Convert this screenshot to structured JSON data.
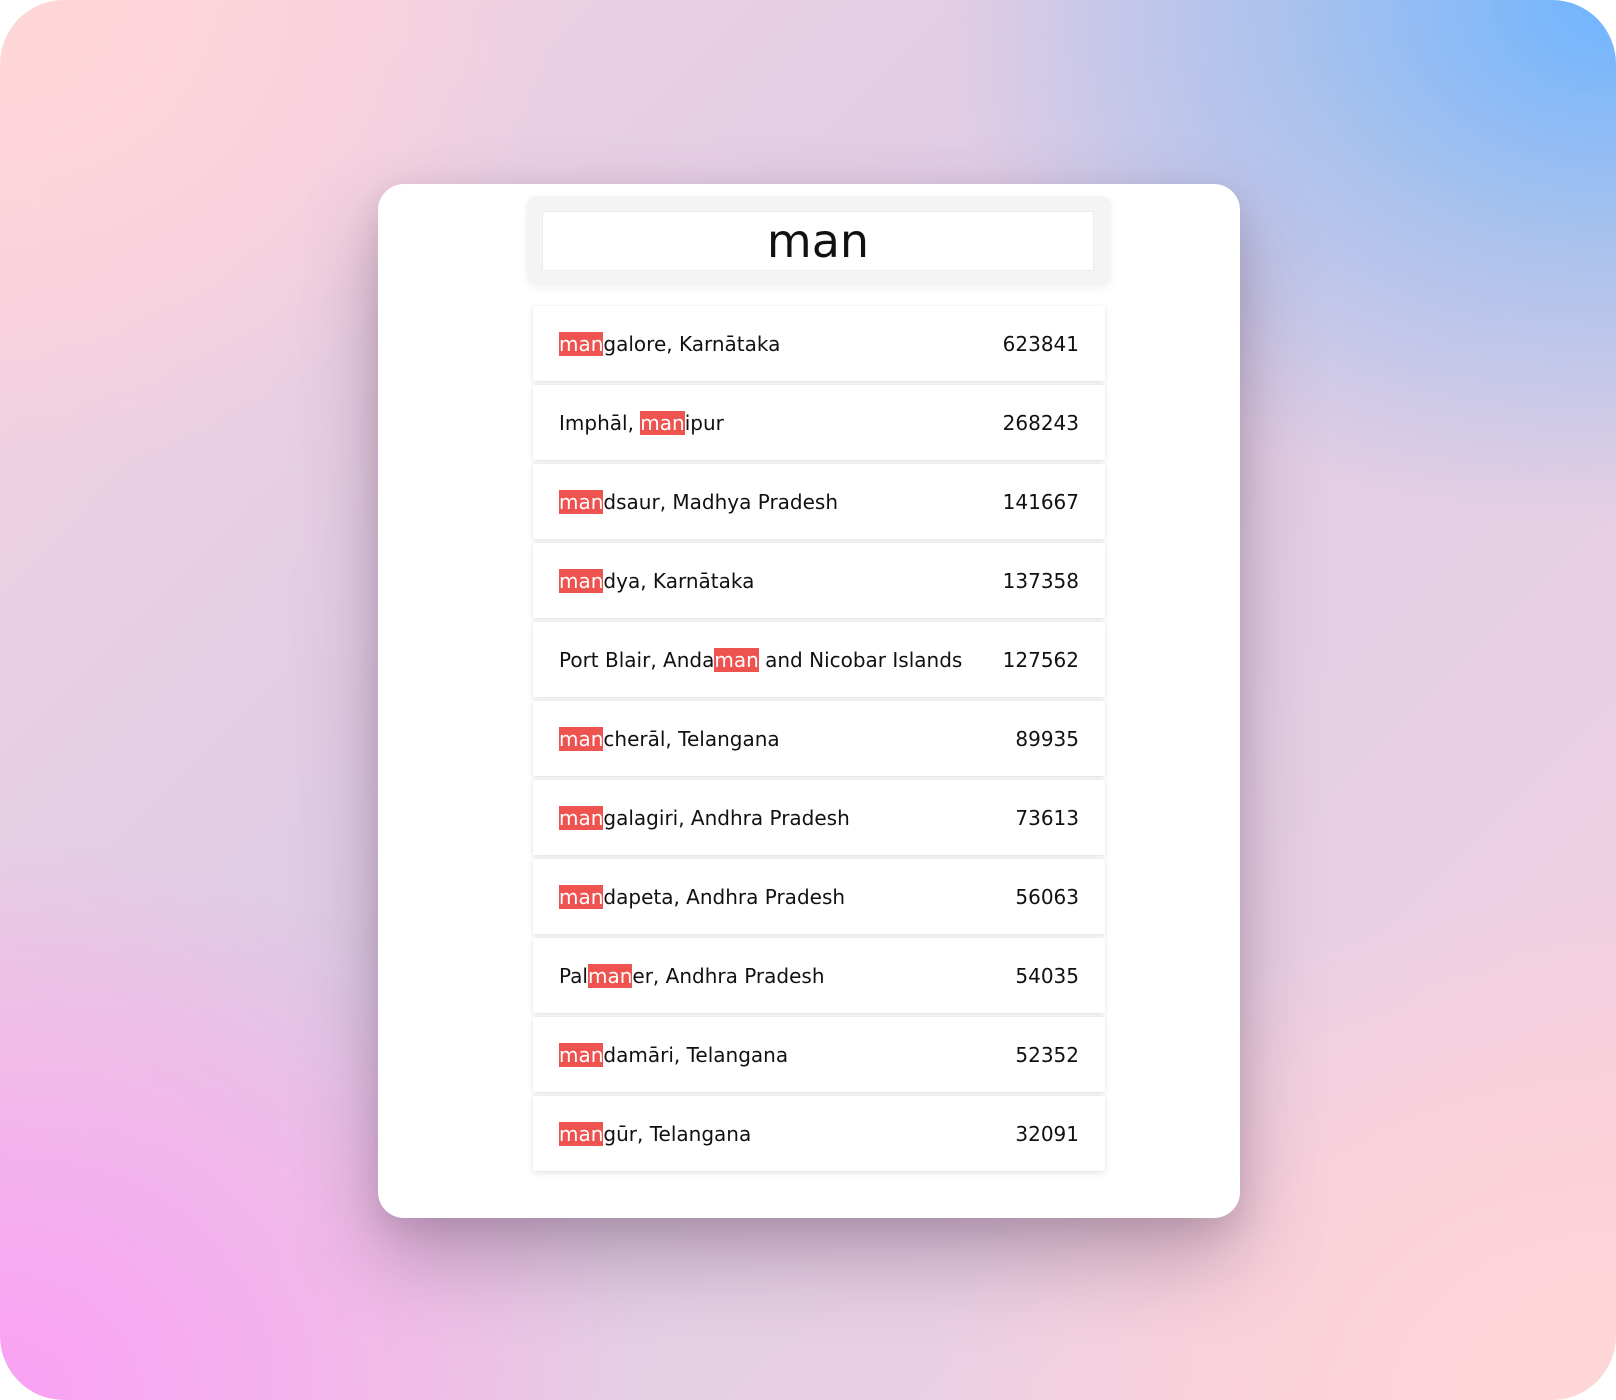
{
  "search": {
    "value": "man",
    "placeholder": ""
  },
  "highlight_color": "#ef5350",
  "results": [
    {
      "pre": "",
      "match": "man",
      "post": "galore, Karnātaka",
      "population": "623841"
    },
    {
      "pre": "Imphāl, ",
      "match": "man",
      "post": "ipur",
      "population": "268243"
    },
    {
      "pre": "",
      "match": "man",
      "post": "dsaur, Madhya Pradesh",
      "population": "141667"
    },
    {
      "pre": "",
      "match": "man",
      "post": "dya, Karnātaka",
      "population": "137358"
    },
    {
      "pre": "Port Blair, Anda",
      "match": "man",
      "post": " and Nicobar Islands",
      "population": "127562"
    },
    {
      "pre": "",
      "match": "man",
      "post": "cherāl, Telangana",
      "population": "89935"
    },
    {
      "pre": "",
      "match": "man",
      "post": "galagiri, Andhra Pradesh",
      "population": "73613"
    },
    {
      "pre": "",
      "match": "man",
      "post": "dapeta, Andhra Pradesh",
      "population": "56063"
    },
    {
      "pre": "Pal",
      "match": "man",
      "post": "er, Andhra Pradesh",
      "population": "54035"
    },
    {
      "pre": "",
      "match": "man",
      "post": "damāri, Telangana",
      "population": "52352"
    },
    {
      "pre": "",
      "match": "man",
      "post": "gūr, Telangana",
      "population": "32091"
    }
  ]
}
